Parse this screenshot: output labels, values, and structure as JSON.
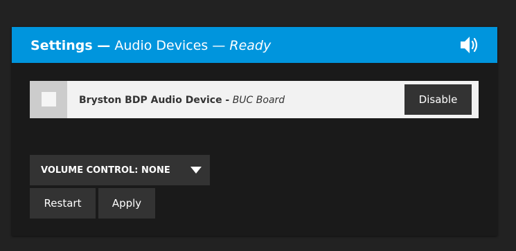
{
  "header": {
    "title_settings": "Settings —",
    "title_section": "Audio Devices —",
    "title_status": "Ready",
    "icon": "speaker-volume-icon"
  },
  "device": {
    "name": "Bryston BDP Audio Device -",
    "board": "BUC Board",
    "checked": false,
    "disable_label": "Disable"
  },
  "volume": {
    "label": "VOLUME CONTROL: NONE"
  },
  "actions": {
    "restart_label": "Restart",
    "apply_label": "Apply"
  },
  "colors": {
    "accent": "#0095dd",
    "page_bg": "#222222",
    "panel_bg": "#1a1a1a",
    "button_bg": "#333333",
    "row_bg": "#f2f2f2"
  }
}
